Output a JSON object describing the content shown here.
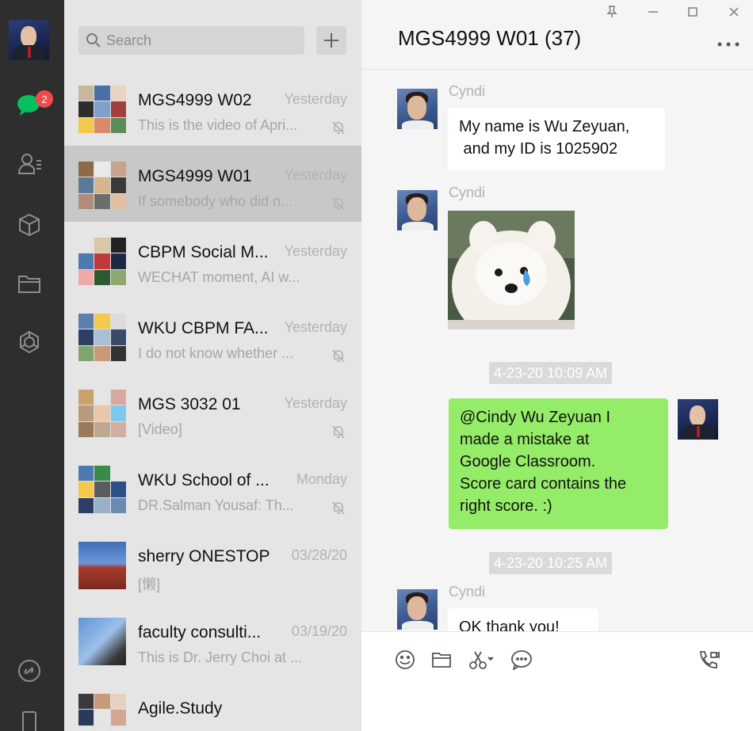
{
  "rail": {
    "unread_count": "2",
    "icons": [
      "chat-icon",
      "contacts-icon",
      "cube-icon",
      "folder-icon",
      "moments-icon",
      "link-icon",
      "phone-icon"
    ]
  },
  "search": {
    "placeholder": "Search"
  },
  "chats": [
    {
      "name": "MGS4999 W02",
      "time": "Yesterday",
      "preview": "This is the video of Apri...",
      "muted": true,
      "active": false
    },
    {
      "name": "MGS4999 W01",
      "time": "Yesterday",
      "preview": "If somebody who did n...",
      "muted": true,
      "active": true
    },
    {
      "name": "CBPM Social M...",
      "time": "Yesterday",
      "preview": "WECHAT moment, AI w...",
      "muted": false,
      "active": false
    },
    {
      "name": "WKU CBPM FA...",
      "time": "Yesterday",
      "preview": "I do not know whether ...",
      "muted": true,
      "active": false
    },
    {
      "name": "MGS 3032 01",
      "time": "Yesterday",
      "preview": "[Video]",
      "muted": true,
      "active": false
    },
    {
      "name": "WKU School of ...",
      "time": "Monday",
      "preview": "DR.Salman Yousaf:  Th...",
      "muted": true,
      "active": false
    },
    {
      "name": "sherry ONESTOP",
      "time": "03/28/20",
      "preview": "[懒]",
      "muted": false,
      "active": false
    },
    {
      "name": "faculty consulti...",
      "time": "03/19/20",
      "preview": "This is Dr. Jerry Choi at ...",
      "muted": false,
      "active": false
    },
    {
      "name": "Agile.Study",
      "time": "",
      "preview": "",
      "muted": false,
      "active": false
    }
  ],
  "conversation": {
    "title": "MGS4999 W01 (37)",
    "messages": [
      {
        "sender": "Cyndi",
        "text_line1": "My name is Wu Zeyuan,",
        "text_line2": " and my ID is 1025902"
      },
      {
        "sender": "Cyndi",
        "image": "samoyed-puppy-photo"
      },
      {
        "timestamp": "4-23-20 10:09 AM"
      },
      {
        "sender": "me",
        "text_line1": "@Cindy Wu Zeyuan I",
        "text_line2": "made a mistake at",
        "text_line3": "Google Classroom.",
        "text_line4": "Score card contains the",
        "text_line5": "right score. :)"
      },
      {
        "timestamp": "4-23-20 10:25 AM"
      },
      {
        "sender": "Cyndi",
        "text_line1": "OK thank you!"
      }
    ]
  },
  "colors": {
    "rail_bg": "#2e2e2e",
    "list_bg": "#e6e5e5",
    "active_chat_bg": "#c9c8c8",
    "outgoing_bubble": "#95ec69",
    "incoming_bubble": "#ffffff",
    "badge": "#f04a4a",
    "chat_icon_green": "#07c160"
  }
}
